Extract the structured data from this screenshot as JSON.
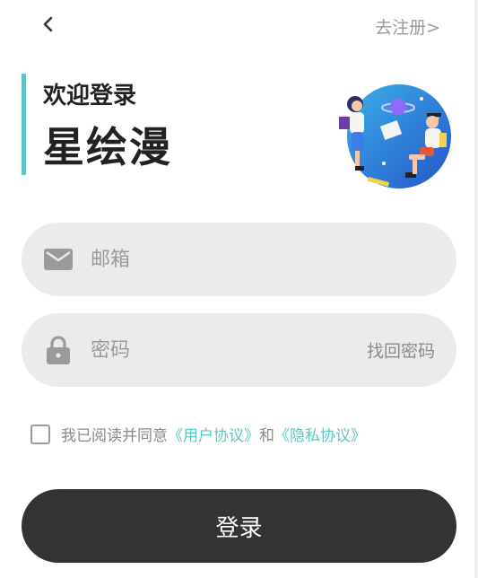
{
  "header": {
    "back_icon": "chevron-left-icon",
    "register_label": "去注册>"
  },
  "title": {
    "welcome": "欢迎登录",
    "brand": "星绘漫",
    "accent_color": "#5cc7c2"
  },
  "illustration": {
    "description_icon": "space-students-illustration"
  },
  "form": {
    "email": {
      "icon": "mail-icon",
      "value": "",
      "placeholder": "邮箱"
    },
    "password": {
      "icon": "lock-icon",
      "value": "",
      "placeholder": "密码",
      "forgot_label": "找回密码"
    }
  },
  "agreement": {
    "checked": false,
    "prefix": "我已阅读并同意",
    "user_agreement": "《用户协议》",
    "conjunction": "和",
    "privacy_agreement": "《隐私协议》"
  },
  "login_button": {
    "label": "登录",
    "bg_color": "#333333"
  }
}
